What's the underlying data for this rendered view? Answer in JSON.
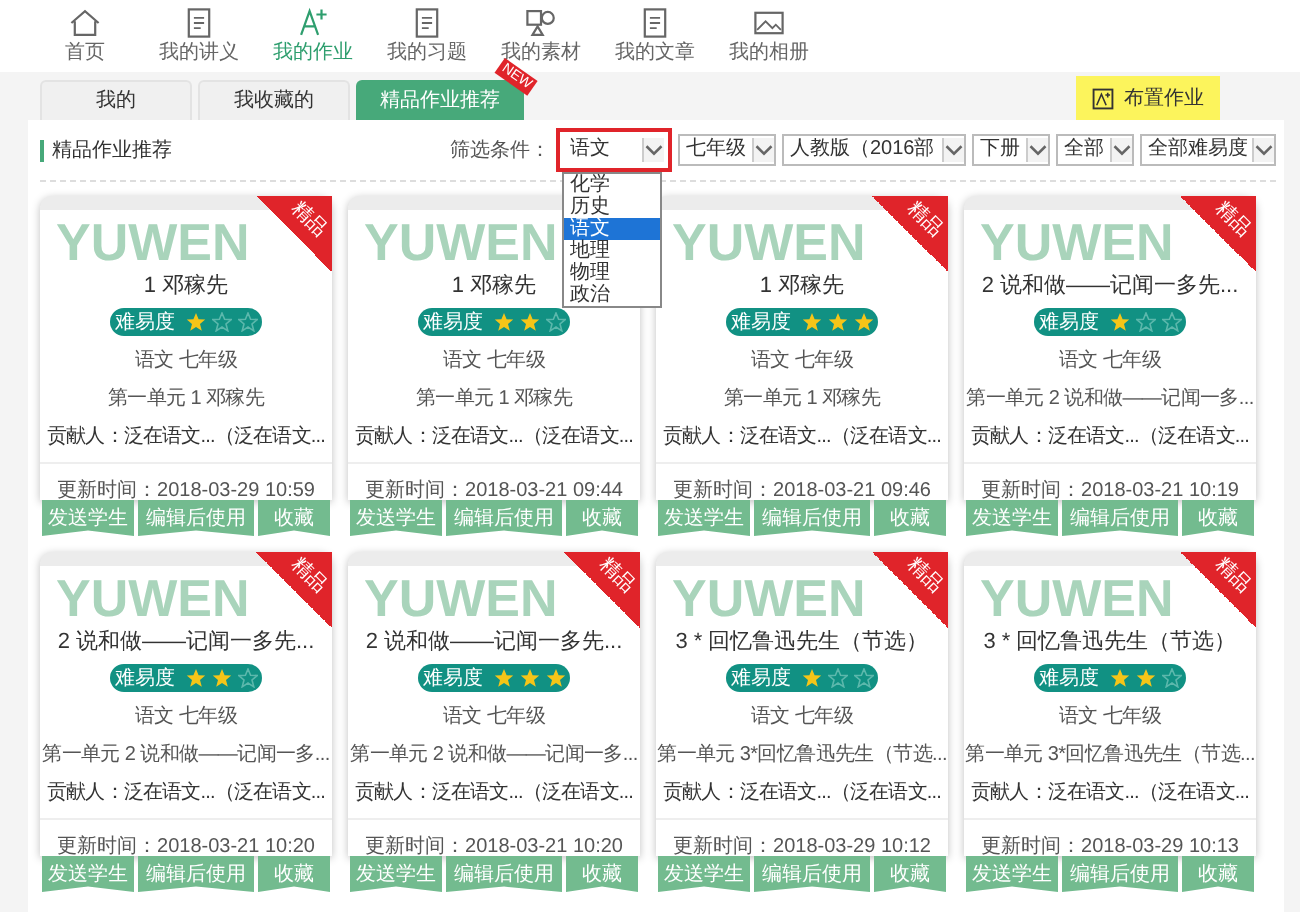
{
  "nav": [
    {
      "label": "首页",
      "selected": false
    },
    {
      "label": "我的讲义",
      "selected": false
    },
    {
      "label": "我的作业",
      "selected": true
    },
    {
      "label": "我的习题",
      "selected": false
    },
    {
      "label": "我的素材",
      "selected": false
    },
    {
      "label": "我的文章",
      "selected": false
    },
    {
      "label": "我的相册",
      "selected": false
    }
  ],
  "tabs": [
    {
      "label": "我的",
      "selected": false
    },
    {
      "label": "我收藏的",
      "selected": false
    },
    {
      "label": "精品作业推荐",
      "selected": true,
      "badge": "NEW"
    }
  ],
  "assign_button": "布置作业",
  "section_title": "精品作业推荐",
  "filter_label": "筛选条件：",
  "filters": [
    {
      "value": "语文",
      "highlighted": true,
      "options": [
        {
          "label": "化学",
          "selected": false
        },
        {
          "label": "历史",
          "selected": false
        },
        {
          "label": "语文",
          "selected": true
        },
        {
          "label": "地理",
          "selected": false
        },
        {
          "label": "物理",
          "selected": false
        },
        {
          "label": "政治",
          "selected": false
        }
      ]
    },
    {
      "value": "七年级",
      "highlighted": false
    },
    {
      "value": "人教版（2016部",
      "highlighted": false
    },
    {
      "value": "下册",
      "highlighted": false
    },
    {
      "value": "全部",
      "highlighted": false
    },
    {
      "value": "全部难易度",
      "highlighted": false
    }
  ],
  "cards": [
    {
      "watermark": "YUWEN",
      "ribbon": "精品",
      "title": "1 邓稼先",
      "difficulty_label": "难易度",
      "stars": 1,
      "subject": "语文  七年级",
      "unit": "第一单元  1 邓稼先",
      "contributor": "贡献人：泛在语文...（泛在语文...",
      "updated": "更新时间：2018-03-29 10:59",
      "actions": [
        "发送学生",
        "编辑后使用",
        "收藏"
      ]
    },
    {
      "watermark": "YUWEN",
      "title": "1 邓稼先",
      "difficulty_label": "难易度",
      "stars": 2,
      "subject": "语文  七年级",
      "unit": "第一单元  1 邓稼先",
      "contributor": "贡献人：泛在语文...（泛在语文...",
      "updated": "更新时间：2018-03-21 09:44",
      "actions": [
        "发送学生",
        "编辑后使用",
        "收藏"
      ]
    },
    {
      "watermark": "YUWEN",
      "ribbon": "精品",
      "title": "1 邓稼先",
      "difficulty_label": "难易度",
      "stars": 3,
      "subject": "语文  七年级",
      "unit": "第一单元  1 邓稼先",
      "contributor": "贡献人：泛在语文...（泛在语文...",
      "updated": "更新时间：2018-03-21 09:46",
      "actions": [
        "发送学生",
        "编辑后使用",
        "收藏"
      ]
    },
    {
      "watermark": "YUWEN",
      "ribbon": "精品",
      "title": "2 说和做——记闻一多先...",
      "difficulty_label": "难易度",
      "stars": 1,
      "subject": "语文  七年级",
      "unit": "第一单元  2 说和做——记闻一多...",
      "contributor": "贡献人：泛在语文...（泛在语文...",
      "updated": "更新时间：2018-03-21 10:19",
      "actions": [
        "发送学生",
        "编辑后使用",
        "收藏"
      ]
    },
    {
      "watermark": "YUWEN",
      "ribbon": "精品",
      "title": "2 说和做——记闻一多先...",
      "difficulty_label": "难易度",
      "stars": 2,
      "subject": "语文  七年级",
      "unit": "第一单元  2 说和做——记闻一多...",
      "contributor": "贡献人：泛在语文...（泛在语文...",
      "updated": "更新时间：2018-03-21 10:20",
      "actions": [
        "发送学生",
        "编辑后使用",
        "收藏"
      ]
    },
    {
      "watermark": "YUWEN",
      "ribbon": "精品",
      "title": "2 说和做——记闻一多先...",
      "difficulty_label": "难易度",
      "stars": 3,
      "subject": "语文  七年级",
      "unit": "第一单元  2 说和做——记闻一多...",
      "contributor": "贡献人：泛在语文...（泛在语文...",
      "updated": "更新时间：2018-03-21 10:20",
      "actions": [
        "发送学生",
        "编辑后使用",
        "收藏"
      ]
    },
    {
      "watermark": "YUWEN",
      "ribbon": "精品",
      "title": "3 * 回忆鲁迅先生（节选）",
      "difficulty_label": "难易度",
      "stars": 1,
      "subject": "语文  七年级",
      "unit": "第一单元  3*回忆鲁迅先生（节选...",
      "contributor": "贡献人：泛在语文...（泛在语文...",
      "updated": "更新时间：2018-03-29 10:12",
      "actions": [
        "发送学生",
        "编辑后使用",
        "收藏"
      ]
    },
    {
      "watermark": "YUWEN",
      "ribbon": "精品",
      "title": "3 * 回忆鲁迅先生（节选）",
      "difficulty_label": "难易度",
      "stars": 2,
      "subject": "语文  七年级",
      "unit": "第一单元  3*回忆鲁迅先生（节选...",
      "contributor": "贡献人：泛在语文...（泛在语文...",
      "updated": "更新时间：2018-03-29 10:13",
      "actions": [
        "发送学生",
        "编辑后使用",
        "收藏"
      ]
    }
  ]
}
